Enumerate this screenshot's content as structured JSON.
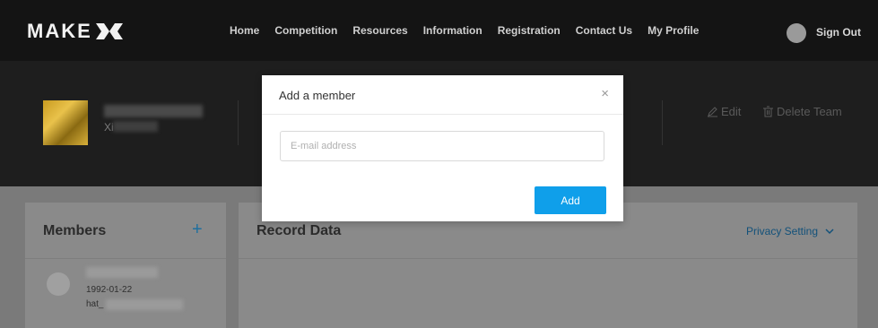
{
  "nav": {
    "logo_text": "MAKE",
    "links": [
      "Home",
      "Competition",
      "Resources",
      "Information",
      "Registration",
      "Contact Us",
      "My Profile"
    ],
    "sign_out": "Sign Out"
  },
  "team": {
    "name": "",
    "sub_prefix": "Xi",
    "edit_label": "Edit",
    "delete_label": "Delete Team"
  },
  "members": {
    "title": "Members",
    "add_symbol": "+",
    "items": [
      {
        "date": "1992-01-22",
        "line": "hat_"
      }
    ]
  },
  "record": {
    "title": "Record Data",
    "privacy_label": "Privacy Setting"
  },
  "modal": {
    "title": "Add a member",
    "close_symbol": "×",
    "email_placeholder": "E-mail address",
    "email_value": "",
    "add_label": "Add"
  },
  "colors": {
    "accent": "#0f9fea",
    "nav_bg": "#141414",
    "link": "#1e6f9e"
  }
}
